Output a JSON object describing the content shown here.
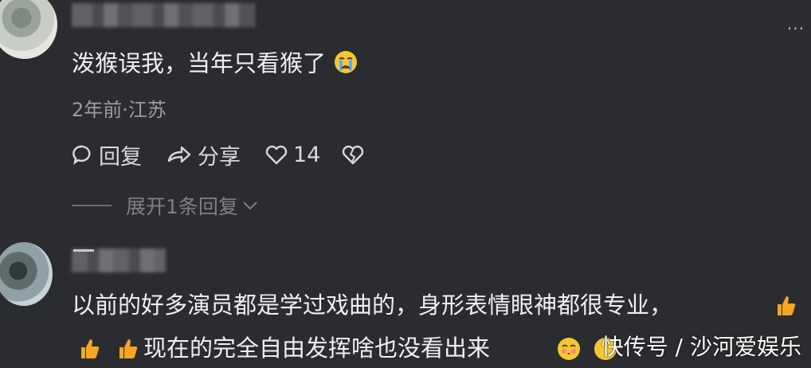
{
  "comment1": {
    "text": "泼猴误我，当年只看猴了",
    "meta": "2年前·江苏",
    "actions": {
      "reply_label": "回复",
      "share_label": "分享",
      "like_count": "14"
    },
    "expand_label": "展开1条回复"
  },
  "comment2": {
    "line1": "以前的好多演员都是学过戏曲的，身形表情眼神都很专业，",
    "line2": "现在的完全自由发挥啥也没看出来"
  },
  "watermark": "快传号 / 沙河爱娱乐",
  "colors": {
    "background": "#2b2c30",
    "text": "#f0f0f2",
    "meta": "#9c9da3",
    "thumb": "#f5a623"
  }
}
